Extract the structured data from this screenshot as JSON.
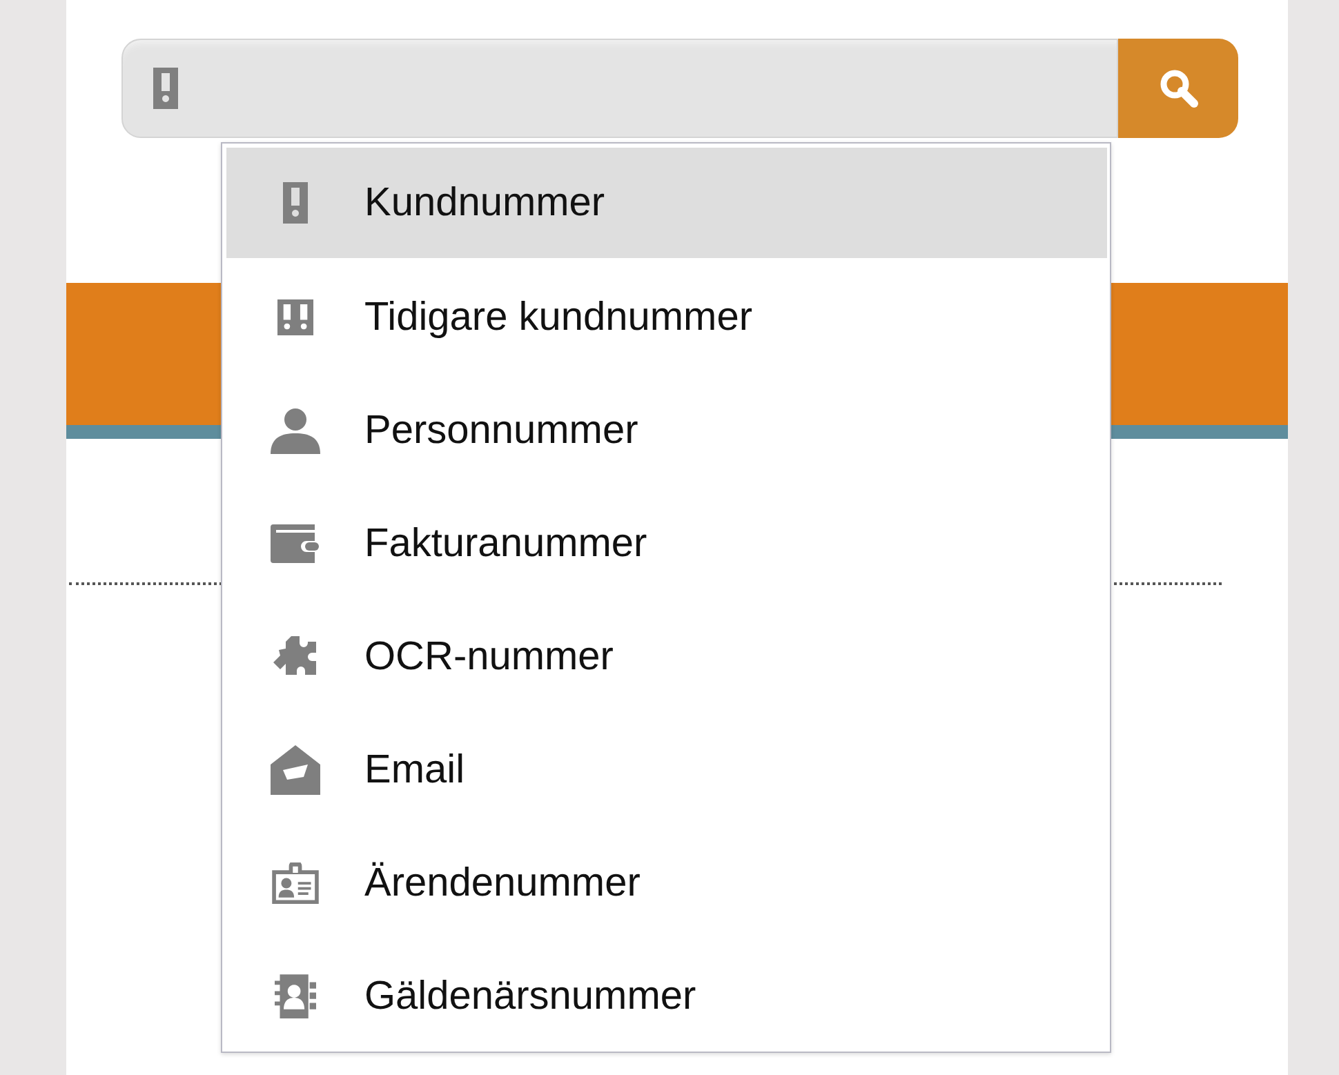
{
  "dropdown": {
    "items": [
      {
        "label": "Kundnummer",
        "selected": true
      },
      {
        "label": "Tidigare kundnummer",
        "selected": false
      },
      {
        "label": "Personnummer",
        "selected": false
      },
      {
        "label": "Fakturanummer",
        "selected": false
      },
      {
        "label": "OCR-nummer",
        "selected": false
      },
      {
        "label": "Email",
        "selected": false
      },
      {
        "label": "Ärendenummer",
        "selected": false
      },
      {
        "label": "Gäldenärsnummer",
        "selected": false
      }
    ]
  }
}
